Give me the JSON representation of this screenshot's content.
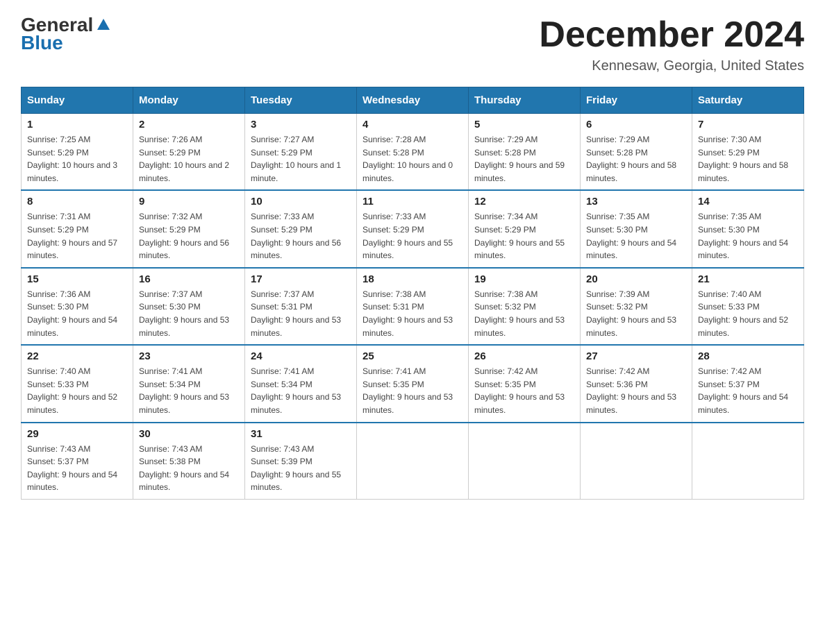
{
  "header": {
    "logo_line1": "General",
    "logo_line2": "Blue",
    "title": "December 2024",
    "subtitle": "Kennesaw, Georgia, United States"
  },
  "weekdays": [
    "Sunday",
    "Monday",
    "Tuesday",
    "Wednesday",
    "Thursday",
    "Friday",
    "Saturday"
  ],
  "weeks": [
    [
      {
        "day": "1",
        "sunrise": "7:25 AM",
        "sunset": "5:29 PM",
        "daylight": "10 hours and 3 minutes."
      },
      {
        "day": "2",
        "sunrise": "7:26 AM",
        "sunset": "5:29 PM",
        "daylight": "10 hours and 2 minutes."
      },
      {
        "day": "3",
        "sunrise": "7:27 AM",
        "sunset": "5:29 PM",
        "daylight": "10 hours and 1 minute."
      },
      {
        "day": "4",
        "sunrise": "7:28 AM",
        "sunset": "5:28 PM",
        "daylight": "10 hours and 0 minutes."
      },
      {
        "day": "5",
        "sunrise": "7:29 AM",
        "sunset": "5:28 PM",
        "daylight": "9 hours and 59 minutes."
      },
      {
        "day": "6",
        "sunrise": "7:29 AM",
        "sunset": "5:28 PM",
        "daylight": "9 hours and 58 minutes."
      },
      {
        "day": "7",
        "sunrise": "7:30 AM",
        "sunset": "5:29 PM",
        "daylight": "9 hours and 58 minutes."
      }
    ],
    [
      {
        "day": "8",
        "sunrise": "7:31 AM",
        "sunset": "5:29 PM",
        "daylight": "9 hours and 57 minutes."
      },
      {
        "day": "9",
        "sunrise": "7:32 AM",
        "sunset": "5:29 PM",
        "daylight": "9 hours and 56 minutes."
      },
      {
        "day": "10",
        "sunrise": "7:33 AM",
        "sunset": "5:29 PM",
        "daylight": "9 hours and 56 minutes."
      },
      {
        "day": "11",
        "sunrise": "7:33 AM",
        "sunset": "5:29 PM",
        "daylight": "9 hours and 55 minutes."
      },
      {
        "day": "12",
        "sunrise": "7:34 AM",
        "sunset": "5:29 PM",
        "daylight": "9 hours and 55 minutes."
      },
      {
        "day": "13",
        "sunrise": "7:35 AM",
        "sunset": "5:30 PM",
        "daylight": "9 hours and 54 minutes."
      },
      {
        "day": "14",
        "sunrise": "7:35 AM",
        "sunset": "5:30 PM",
        "daylight": "9 hours and 54 minutes."
      }
    ],
    [
      {
        "day": "15",
        "sunrise": "7:36 AM",
        "sunset": "5:30 PM",
        "daylight": "9 hours and 54 minutes."
      },
      {
        "day": "16",
        "sunrise": "7:37 AM",
        "sunset": "5:30 PM",
        "daylight": "9 hours and 53 minutes."
      },
      {
        "day": "17",
        "sunrise": "7:37 AM",
        "sunset": "5:31 PM",
        "daylight": "9 hours and 53 minutes."
      },
      {
        "day": "18",
        "sunrise": "7:38 AM",
        "sunset": "5:31 PM",
        "daylight": "9 hours and 53 minutes."
      },
      {
        "day": "19",
        "sunrise": "7:38 AM",
        "sunset": "5:32 PM",
        "daylight": "9 hours and 53 minutes."
      },
      {
        "day": "20",
        "sunrise": "7:39 AM",
        "sunset": "5:32 PM",
        "daylight": "9 hours and 53 minutes."
      },
      {
        "day": "21",
        "sunrise": "7:40 AM",
        "sunset": "5:33 PM",
        "daylight": "9 hours and 52 minutes."
      }
    ],
    [
      {
        "day": "22",
        "sunrise": "7:40 AM",
        "sunset": "5:33 PM",
        "daylight": "9 hours and 52 minutes."
      },
      {
        "day": "23",
        "sunrise": "7:41 AM",
        "sunset": "5:34 PM",
        "daylight": "9 hours and 53 minutes."
      },
      {
        "day": "24",
        "sunrise": "7:41 AM",
        "sunset": "5:34 PM",
        "daylight": "9 hours and 53 minutes."
      },
      {
        "day": "25",
        "sunrise": "7:41 AM",
        "sunset": "5:35 PM",
        "daylight": "9 hours and 53 minutes."
      },
      {
        "day": "26",
        "sunrise": "7:42 AM",
        "sunset": "5:35 PM",
        "daylight": "9 hours and 53 minutes."
      },
      {
        "day": "27",
        "sunrise": "7:42 AM",
        "sunset": "5:36 PM",
        "daylight": "9 hours and 53 minutes."
      },
      {
        "day": "28",
        "sunrise": "7:42 AM",
        "sunset": "5:37 PM",
        "daylight": "9 hours and 54 minutes."
      }
    ],
    [
      {
        "day": "29",
        "sunrise": "7:43 AM",
        "sunset": "5:37 PM",
        "daylight": "9 hours and 54 minutes."
      },
      {
        "day": "30",
        "sunrise": "7:43 AM",
        "sunset": "5:38 PM",
        "daylight": "9 hours and 54 minutes."
      },
      {
        "day": "31",
        "sunrise": "7:43 AM",
        "sunset": "5:39 PM",
        "daylight": "9 hours and 55 minutes."
      },
      null,
      null,
      null,
      null
    ]
  ],
  "labels": {
    "sunrise_prefix": "Sunrise: ",
    "sunset_prefix": "Sunset: ",
    "daylight_prefix": "Daylight: "
  },
  "colors": {
    "header_bg": "#2176ae",
    "header_text": "#ffffff",
    "border": "#cccccc",
    "row_border": "#2176ae"
  }
}
